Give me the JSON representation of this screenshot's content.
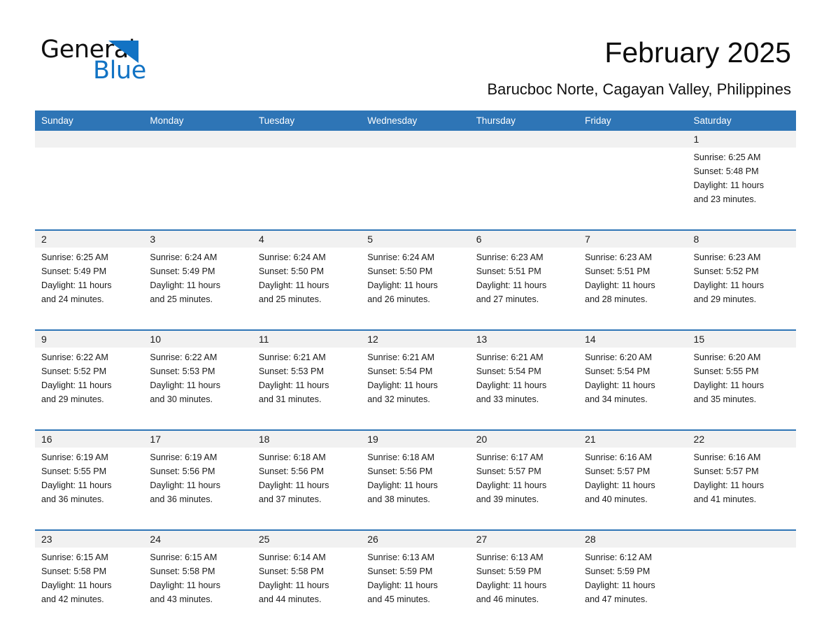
{
  "brand": {
    "name_top": "General",
    "name_bottom": "Blue",
    "accent_color": "#1273c4",
    "triangle_icon": "triangle-logo-icon"
  },
  "header": {
    "title": "February 2025",
    "subtitle": "Barucboc Norte, Cagayan Valley, Philippines"
  },
  "colors": {
    "header_blue": "#2e75b6",
    "row_divider_blue": "#2e75b6",
    "date_band_gray": "#f1f1f1",
    "text": "#1a1a1a"
  },
  "weekdays": [
    "Sunday",
    "Monday",
    "Tuesday",
    "Wednesday",
    "Thursday",
    "Friday",
    "Saturday"
  ],
  "weeks": [
    {
      "days": [
        {
          "date": "",
          "lines": []
        },
        {
          "date": "",
          "lines": []
        },
        {
          "date": "",
          "lines": []
        },
        {
          "date": "",
          "lines": []
        },
        {
          "date": "",
          "lines": []
        },
        {
          "date": "",
          "lines": []
        },
        {
          "date": "1",
          "lines": [
            "Sunrise: 6:25 AM",
            "Sunset: 5:48 PM",
            "Daylight: 11 hours",
            "and 23 minutes."
          ]
        }
      ]
    },
    {
      "days": [
        {
          "date": "2",
          "lines": [
            "Sunrise: 6:25 AM",
            "Sunset: 5:49 PM",
            "Daylight: 11 hours",
            "and 24 minutes."
          ]
        },
        {
          "date": "3",
          "lines": [
            "Sunrise: 6:24 AM",
            "Sunset: 5:49 PM",
            "Daylight: 11 hours",
            "and 25 minutes."
          ]
        },
        {
          "date": "4",
          "lines": [
            "Sunrise: 6:24 AM",
            "Sunset: 5:50 PM",
            "Daylight: 11 hours",
            "and 25 minutes."
          ]
        },
        {
          "date": "5",
          "lines": [
            "Sunrise: 6:24 AM",
            "Sunset: 5:50 PM",
            "Daylight: 11 hours",
            "and 26 minutes."
          ]
        },
        {
          "date": "6",
          "lines": [
            "Sunrise: 6:23 AM",
            "Sunset: 5:51 PM",
            "Daylight: 11 hours",
            "and 27 minutes."
          ]
        },
        {
          "date": "7",
          "lines": [
            "Sunrise: 6:23 AM",
            "Sunset: 5:51 PM",
            "Daylight: 11 hours",
            "and 28 minutes."
          ]
        },
        {
          "date": "8",
          "lines": [
            "Sunrise: 6:23 AM",
            "Sunset: 5:52 PM",
            "Daylight: 11 hours",
            "and 29 minutes."
          ]
        }
      ]
    },
    {
      "days": [
        {
          "date": "9",
          "lines": [
            "Sunrise: 6:22 AM",
            "Sunset: 5:52 PM",
            "Daylight: 11 hours",
            "and 29 minutes."
          ]
        },
        {
          "date": "10",
          "lines": [
            "Sunrise: 6:22 AM",
            "Sunset: 5:53 PM",
            "Daylight: 11 hours",
            "and 30 minutes."
          ]
        },
        {
          "date": "11",
          "lines": [
            "Sunrise: 6:21 AM",
            "Sunset: 5:53 PM",
            "Daylight: 11 hours",
            "and 31 minutes."
          ]
        },
        {
          "date": "12",
          "lines": [
            "Sunrise: 6:21 AM",
            "Sunset: 5:54 PM",
            "Daylight: 11 hours",
            "and 32 minutes."
          ]
        },
        {
          "date": "13",
          "lines": [
            "Sunrise: 6:21 AM",
            "Sunset: 5:54 PM",
            "Daylight: 11 hours",
            "and 33 minutes."
          ]
        },
        {
          "date": "14",
          "lines": [
            "Sunrise: 6:20 AM",
            "Sunset: 5:54 PM",
            "Daylight: 11 hours",
            "and 34 minutes."
          ]
        },
        {
          "date": "15",
          "lines": [
            "Sunrise: 6:20 AM",
            "Sunset: 5:55 PM",
            "Daylight: 11 hours",
            "and 35 minutes."
          ]
        }
      ]
    },
    {
      "days": [
        {
          "date": "16",
          "lines": [
            "Sunrise: 6:19 AM",
            "Sunset: 5:55 PM",
            "Daylight: 11 hours",
            "and 36 minutes."
          ]
        },
        {
          "date": "17",
          "lines": [
            "Sunrise: 6:19 AM",
            "Sunset: 5:56 PM",
            "Daylight: 11 hours",
            "and 36 minutes."
          ]
        },
        {
          "date": "18",
          "lines": [
            "Sunrise: 6:18 AM",
            "Sunset: 5:56 PM",
            "Daylight: 11 hours",
            "and 37 minutes."
          ]
        },
        {
          "date": "19",
          "lines": [
            "Sunrise: 6:18 AM",
            "Sunset: 5:56 PM",
            "Daylight: 11 hours",
            "and 38 minutes."
          ]
        },
        {
          "date": "20",
          "lines": [
            "Sunrise: 6:17 AM",
            "Sunset: 5:57 PM",
            "Daylight: 11 hours",
            "and 39 minutes."
          ]
        },
        {
          "date": "21",
          "lines": [
            "Sunrise: 6:16 AM",
            "Sunset: 5:57 PM",
            "Daylight: 11 hours",
            "and 40 minutes."
          ]
        },
        {
          "date": "22",
          "lines": [
            "Sunrise: 6:16 AM",
            "Sunset: 5:57 PM",
            "Daylight: 11 hours",
            "and 41 minutes."
          ]
        }
      ]
    },
    {
      "days": [
        {
          "date": "23",
          "lines": [
            "Sunrise: 6:15 AM",
            "Sunset: 5:58 PM",
            "Daylight: 11 hours",
            "and 42 minutes."
          ]
        },
        {
          "date": "24",
          "lines": [
            "Sunrise: 6:15 AM",
            "Sunset: 5:58 PM",
            "Daylight: 11 hours",
            "and 43 minutes."
          ]
        },
        {
          "date": "25",
          "lines": [
            "Sunrise: 6:14 AM",
            "Sunset: 5:58 PM",
            "Daylight: 11 hours",
            "and 44 minutes."
          ]
        },
        {
          "date": "26",
          "lines": [
            "Sunrise: 6:13 AM",
            "Sunset: 5:59 PM",
            "Daylight: 11 hours",
            "and 45 minutes."
          ]
        },
        {
          "date": "27",
          "lines": [
            "Sunrise: 6:13 AM",
            "Sunset: 5:59 PM",
            "Daylight: 11 hours",
            "and 46 minutes."
          ]
        },
        {
          "date": "28",
          "lines": [
            "Sunrise: 6:12 AM",
            "Sunset: 5:59 PM",
            "Daylight: 11 hours",
            "and 47 minutes."
          ]
        },
        {
          "date": "",
          "lines": []
        }
      ]
    }
  ]
}
